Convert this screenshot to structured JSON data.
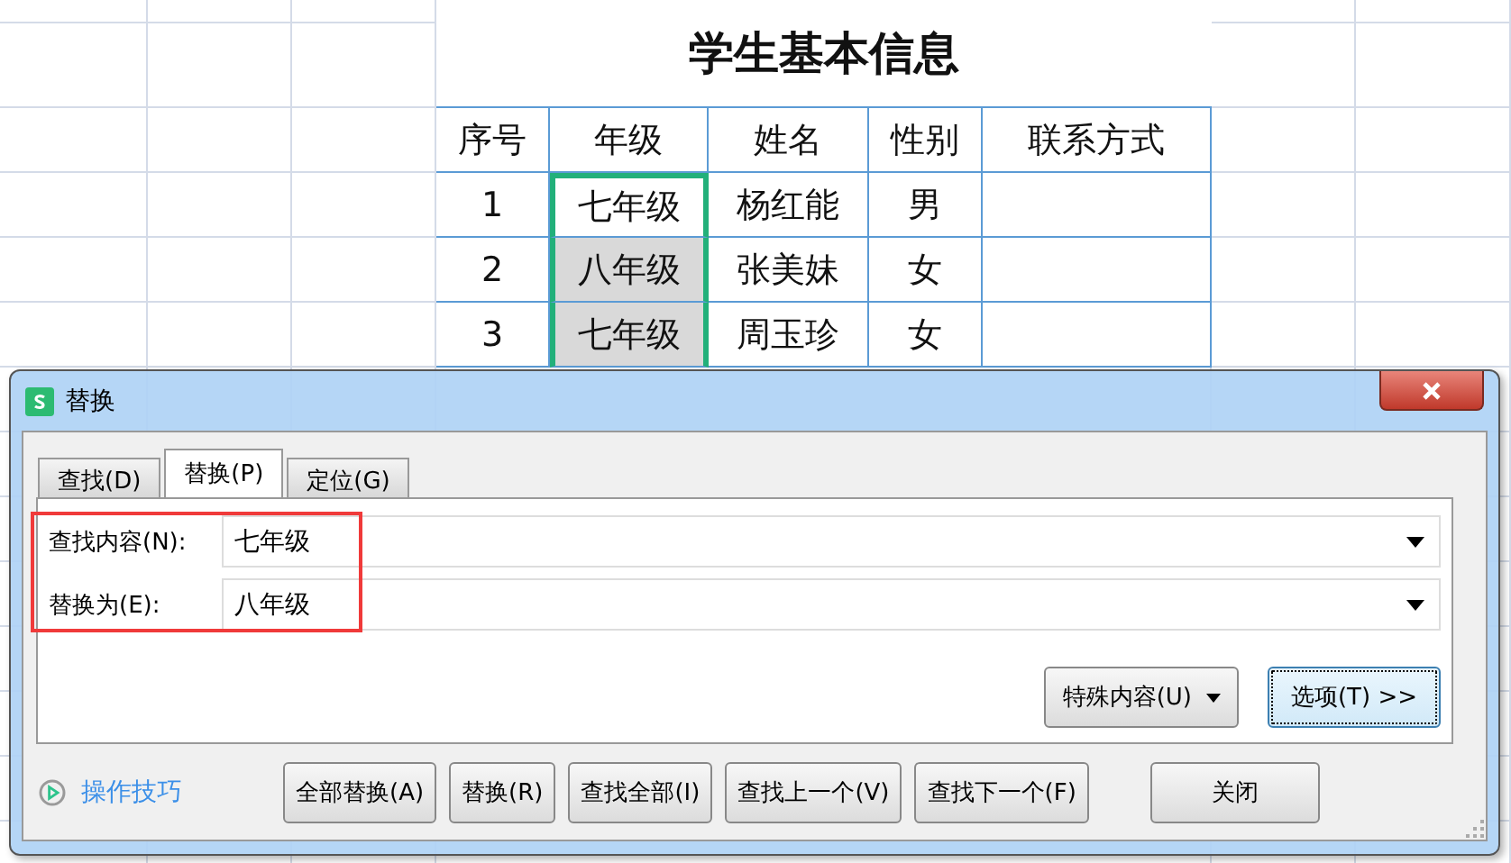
{
  "sheet": {
    "title": "学生基本信息",
    "columns": [
      "序号",
      "年级",
      "姓名",
      "性别",
      "联系方式"
    ],
    "rows": [
      {
        "index": "1",
        "grade": {
          "text": "七年级",
          "selected": true,
          "active": true
        },
        "name": "杨红能",
        "gender": "男"
      },
      {
        "index": "2",
        "grade": {
          "text": "八年级",
          "selected": true,
          "active": false
        },
        "name": "张美妹",
        "gender": "女"
      },
      {
        "index": "3",
        "grade": {
          "text": "七年级",
          "selected": true,
          "active": false
        },
        "name": "周玉珍",
        "gender": "女"
      }
    ]
  },
  "dialog": {
    "title": "替换",
    "tabs": [
      {
        "label": "查找(D)",
        "selected": false
      },
      {
        "label": "替换(P)",
        "selected": true
      },
      {
        "label": "定位(G)",
        "selected": false
      }
    ],
    "fields": [
      {
        "label": "查找内容(N):",
        "value": "七年级"
      },
      {
        "label": "替换为(E):",
        "value": "八年级"
      }
    ],
    "special_button": "特殊内容(U)",
    "options_button": {
      "label": "选项(T) >>",
      "focused": true
    },
    "tips_link": "操作技巧",
    "buttons": [
      "全部替换(A)",
      "替换(R)",
      "查找全部(I)",
      "查找上一个(V)",
      "查找下一个(F)"
    ],
    "close_button": "关闭"
  }
}
